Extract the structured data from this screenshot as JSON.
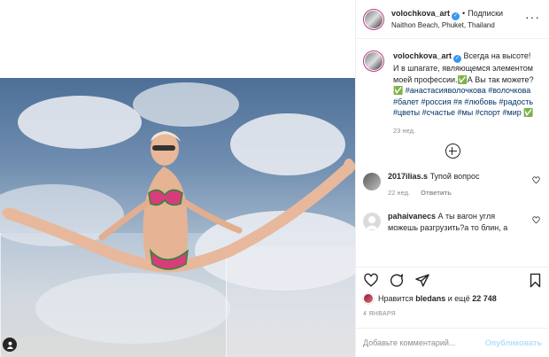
{
  "post": {
    "username": "volochkova_art",
    "follow_label": "Подписки",
    "location": "Naithon Beach, Phuket, Thailand"
  },
  "caption": {
    "username": "volochkova_art",
    "text": "Всегда на высоте! И в шпагате, являющемся элементом моей профессии.✅А Вы так можете? ✅",
    "hashtags": "#анастасияволочкова #волочкова #балет #россия #я #любовь #радость #цветы #счастье #мы #спорт #мир ✅",
    "time": "23 нед."
  },
  "comments": [
    {
      "username": "2017ilias.s",
      "text": "Тупой вопрос",
      "time": "22 нед.",
      "reply": "Ответить"
    },
    {
      "username": "pahaivanecs",
      "text": "А ты вагон угля можешь разгрузить?а то блин, а",
      "time": "",
      "reply": ""
    }
  ],
  "likes": {
    "prefix": "Нравится",
    "user": "bledans",
    "connector": "и ещё",
    "count": "22 748"
  },
  "date": "4 ЯНВАРЯ",
  "composer": {
    "placeholder": "Добавьте комментарий...",
    "post_label": "Опубликовать"
  },
  "icons": {
    "verified": "verified-badge-icon",
    "more": "more-options-icon",
    "heart": "heart-icon",
    "comment": "comment-icon",
    "share": "share-icon",
    "save": "bookmark-icon",
    "load_more": "plus-circle-icon",
    "user_tag": "user-tag-icon"
  },
  "colors": {
    "link": "#003569",
    "verified": "#3897f0",
    "muted": "#8e8e8e",
    "post_button_disabled": "#b2dffc"
  }
}
